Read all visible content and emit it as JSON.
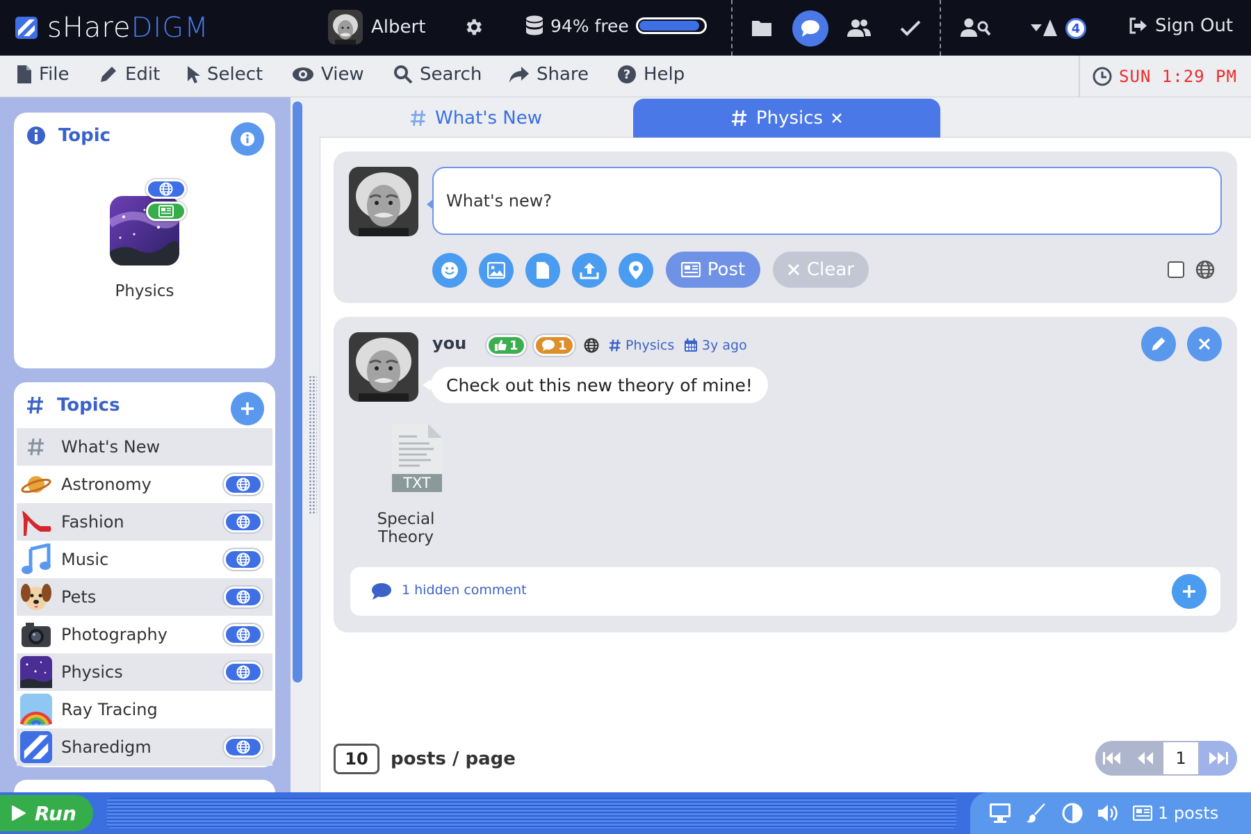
{
  "app": {
    "logo_text_a": "sHare",
    "logo_text_b": "DIGM"
  },
  "topbar": {
    "user_name": "Albert",
    "storage_text": "94% free",
    "storage_fraction": 0.94,
    "notification_count": "4",
    "sign_out_label": "Sign Out"
  },
  "menu": {
    "items": [
      {
        "label": "File",
        "icon": "file-icon"
      },
      {
        "label": "Edit",
        "icon": "pencil-icon"
      },
      {
        "label": "Select",
        "icon": "pointer-icon"
      },
      {
        "label": "View",
        "icon": "eye-icon"
      },
      {
        "label": "Search",
        "icon": "search-icon"
      },
      {
        "label": "Share",
        "icon": "share-icon"
      },
      {
        "label": "Help",
        "icon": "help-icon"
      }
    ],
    "clock": "SUN 1:29 PM"
  },
  "sidebar": {
    "topic_card_title": "Topic",
    "topic_name": "Physics",
    "topics_title": "Topics",
    "topics": [
      {
        "label": "What's New",
        "icon": "hash-icon",
        "global": false
      },
      {
        "label": "Astronomy",
        "icon": "planet-icon",
        "global": true
      },
      {
        "label": "Fashion",
        "icon": "high-heel-icon",
        "global": true
      },
      {
        "label": "Music",
        "icon": "music-note-icon",
        "global": true
      },
      {
        "label": "Pets",
        "icon": "dog-icon",
        "global": true
      },
      {
        "label": "Photography",
        "icon": "camera-icon",
        "global": true
      },
      {
        "label": "Physics",
        "icon": "galaxy-icon",
        "global": true
      },
      {
        "label": "Ray Tracing",
        "icon": "rainbow-icon",
        "global": false
      },
      {
        "label": "Sharedigm",
        "icon": "sharedigm-logo-icon",
        "global": true
      }
    ]
  },
  "tabs": [
    {
      "label": "What's New",
      "active": false
    },
    {
      "label": "Physics",
      "active": true
    }
  ],
  "composer": {
    "placeholder": "What's new?",
    "post_label": "Post",
    "clear_label": "Clear"
  },
  "post": {
    "author": "you",
    "likes": "1",
    "comments": "1",
    "topic": "Physics",
    "age": "3y ago",
    "text": "Check out this new theory of mine!",
    "attachment_type": "TXT",
    "attachment_name": "Special Theory",
    "hidden_comments": "1 hidden comment"
  },
  "pagination": {
    "per_page": "10",
    "per_page_label": "posts / page",
    "current_page": "1"
  },
  "bottombar": {
    "run_label": "Run",
    "posts_count": "1 posts"
  },
  "colors": {
    "accent": "#4a78e6",
    "topbar": "#0d0f1a",
    "sidebar": "#a9b7e8",
    "run_green": "#36ad4b",
    "clock_red": "#ee2b2b"
  }
}
